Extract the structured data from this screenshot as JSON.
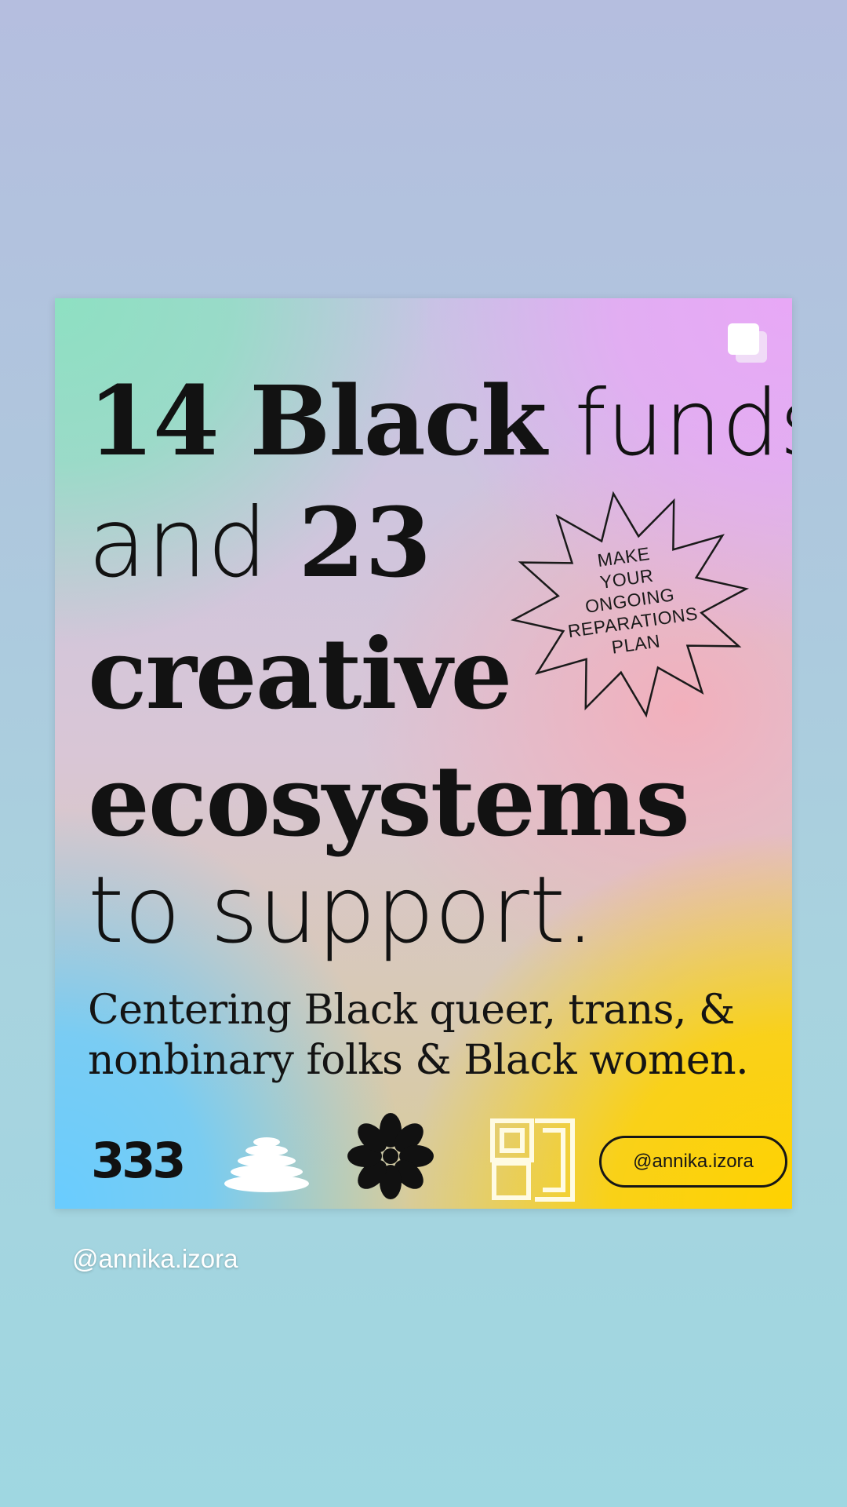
{
  "post": {
    "headline": {
      "line1_bold": "14 Black",
      "line1_thin": "funds",
      "line2_thin": "and",
      "line2_bold": "23",
      "line3": "creative",
      "line4": "ecosystems",
      "line5": "to support."
    },
    "tagline": "Centering Black queer, trans, & nonbinary folks & Black women.",
    "starburst": [
      "MAKE",
      "YOUR",
      "ONGOING",
      "REPARATIONS",
      "PLAN"
    ],
    "logos": {
      "logo_333": "333"
    },
    "handle_pill": "@annika.izora",
    "icons": {
      "multi_image": "multiple-images-icon",
      "stack": "stacked-stones-icon",
      "flower": "flower-icon",
      "pattern": "geometric-tile-icon"
    }
  },
  "story": {
    "handle": "@annika.izora"
  },
  "colors": {
    "text_dark": "#121212",
    "gradient_yellow": "#ffd200",
    "gradient_blue": "#69ccff",
    "gradient_pink": "#e8a8f6",
    "gradient_mint": "#8ee0c2"
  }
}
